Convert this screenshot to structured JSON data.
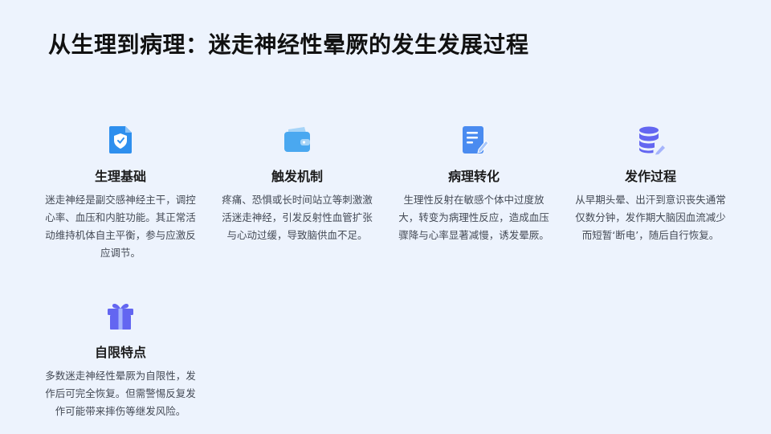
{
  "title": "从生理到病理：迷走神经性晕厥的发生发展过程",
  "cards": [
    {
      "title": "生理基础",
      "text": "迷走神经是副交感神经主干，调控心率、血压和内脏功能。其正常活动维持机体自主平衡，参与应激反应调节。",
      "icon": "shield-doc-icon"
    },
    {
      "title": "触发机制",
      "text": "疼痛、恐惧或长时间站立等刺激激活迷走神经，引发反射性血管扩张与心动过缓，导致脑供血不足。",
      "icon": "wallet-icon"
    },
    {
      "title": "病理转化",
      "text": "生理性反射在敏感个体中过度放大，转变为病理性反应，造成血压骤降与心率显著减慢，诱发晕厥。",
      "icon": "document-edit-icon"
    },
    {
      "title": "发作过程",
      "text": "从早期头晕、出汗到意识丧失通常仅数分钟，发作期大脑因血流减少而短暂‘断电’，随后自行恢复。",
      "icon": "database-edit-icon"
    },
    {
      "title": "自限特点",
      "text": "多数迷走神经性晕厥为自限性，发作后可完全恢复。但需警惕反复发作可能带来摔伤等继发风险。",
      "icon": "gift-icon"
    }
  ],
  "colors": {
    "background": "#edf3fd",
    "blue": "#2e8fee",
    "indigo": "#6366f1"
  }
}
